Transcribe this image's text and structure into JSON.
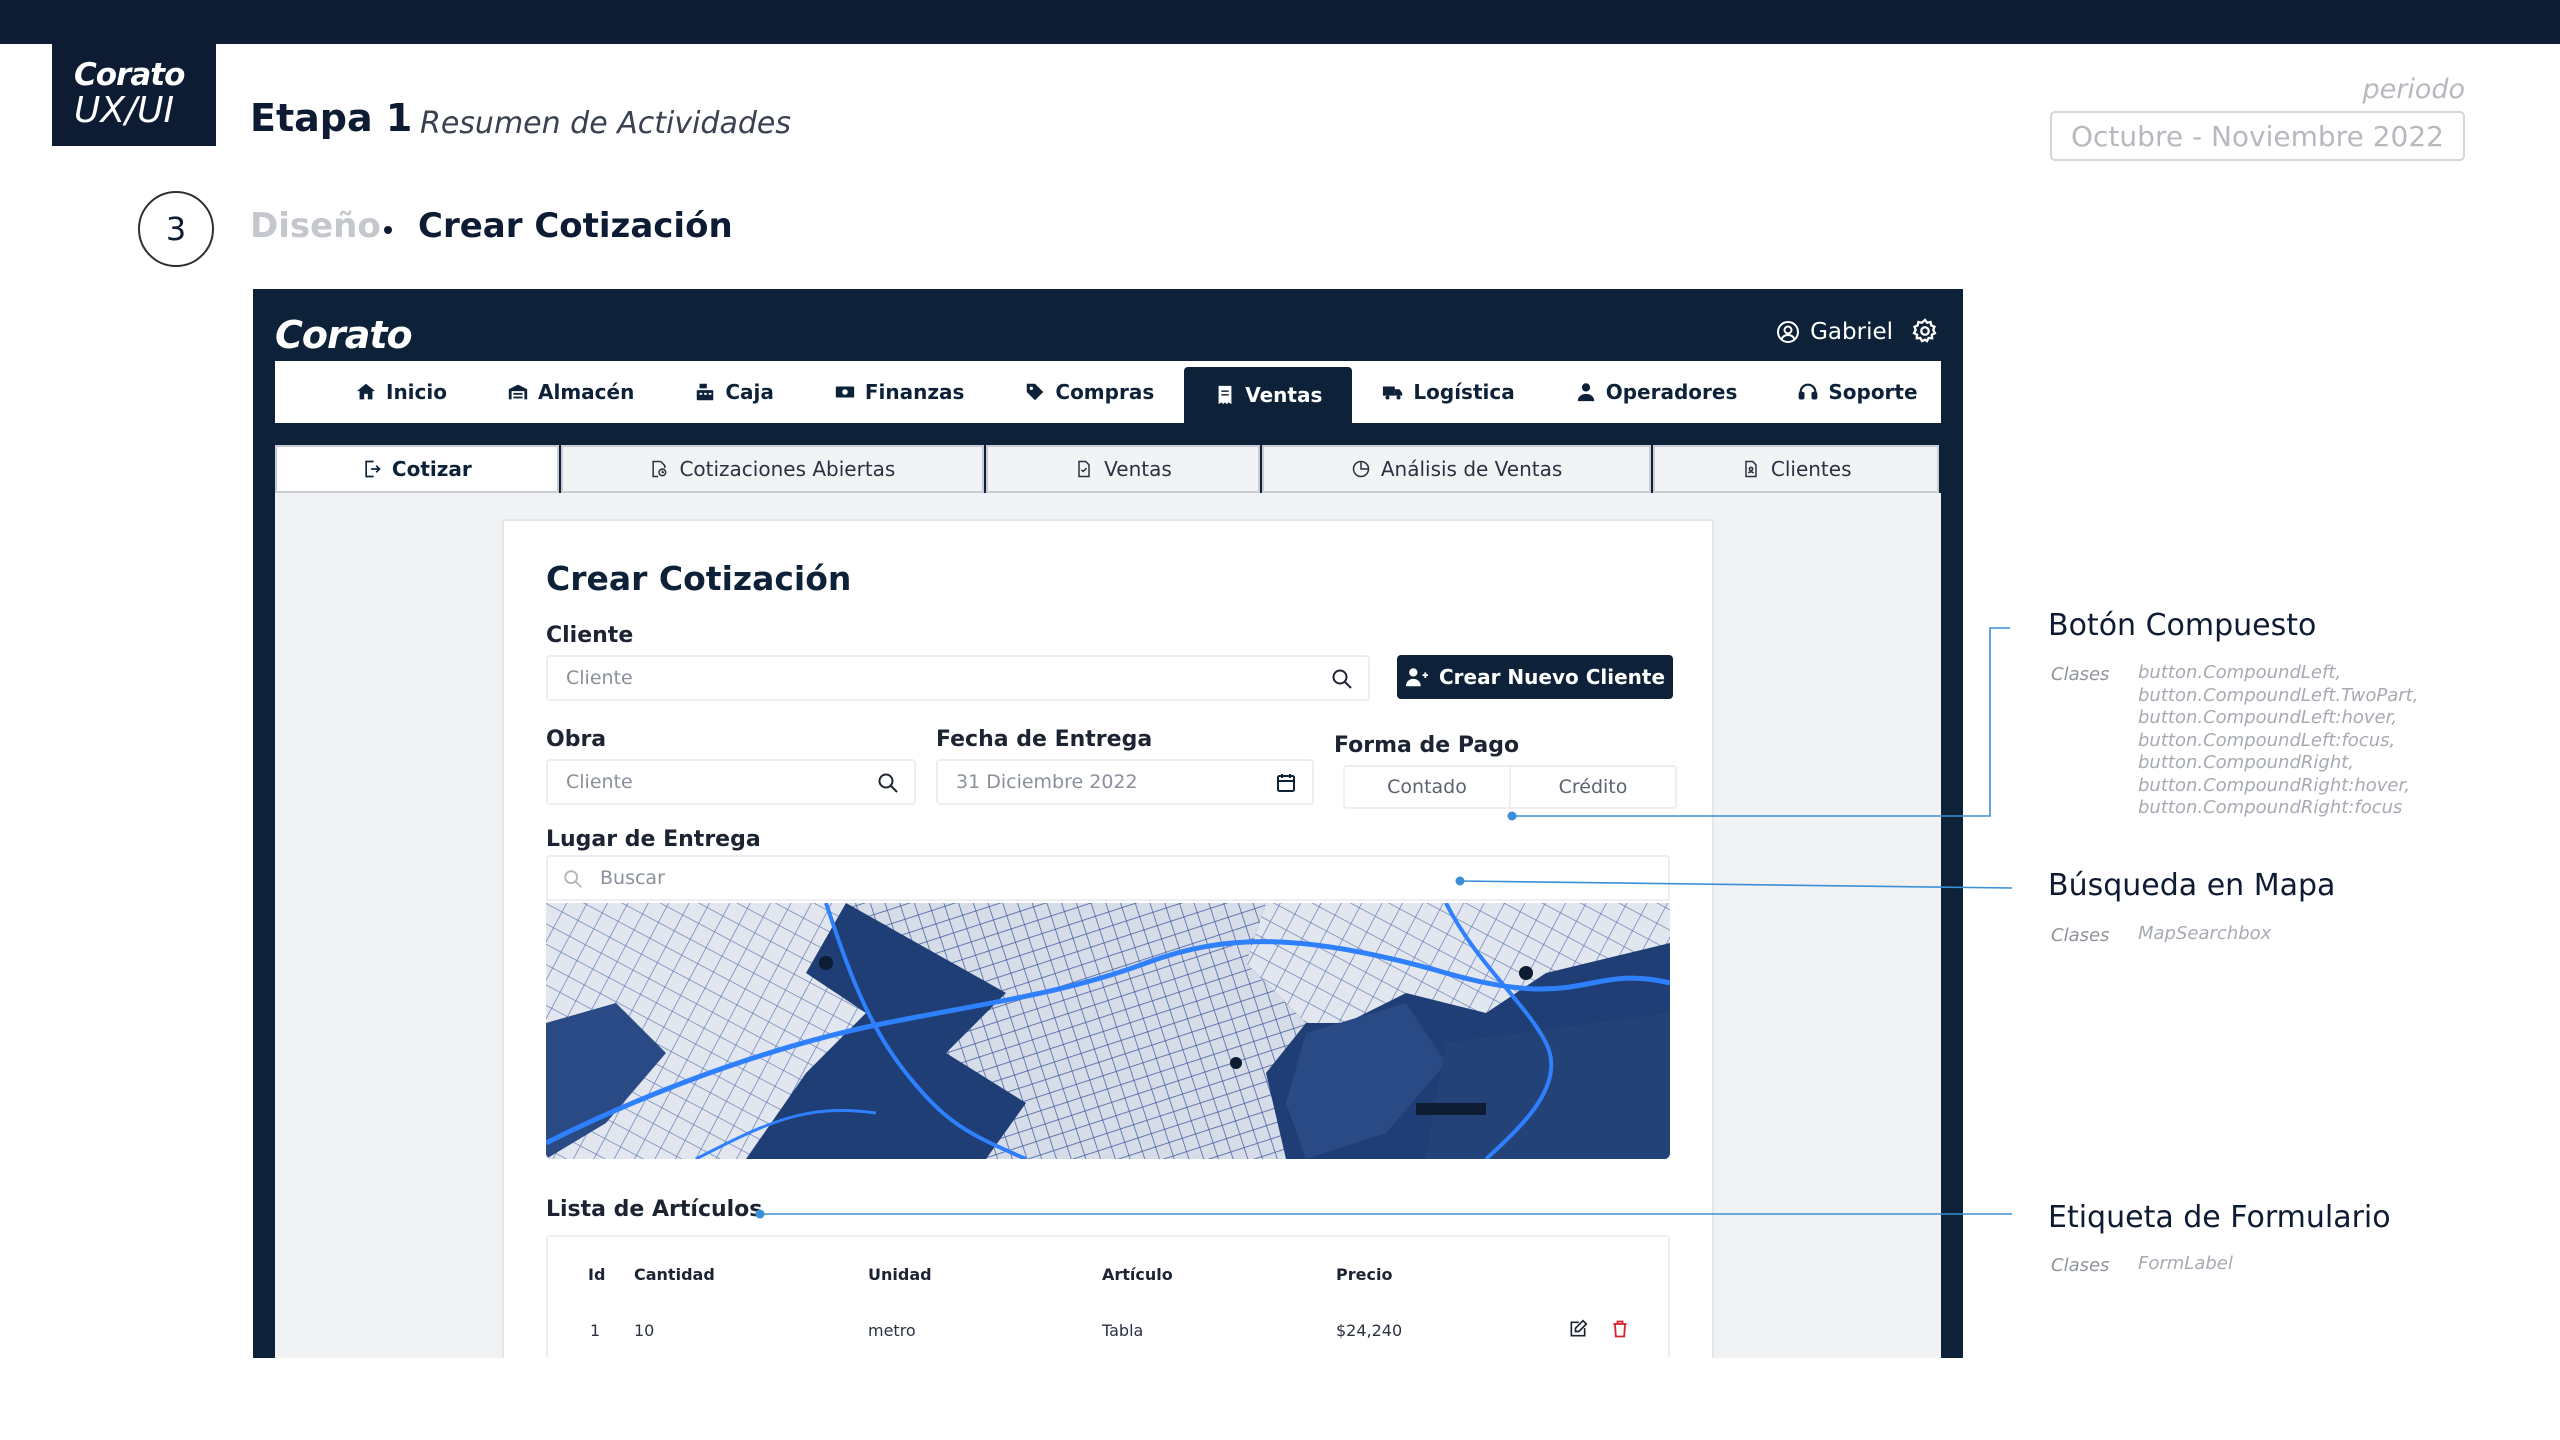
{
  "brand": {
    "line1": "Corato",
    "line2": "UX/UI"
  },
  "header": {
    "stage": "Etapa 1",
    "subtitle": "Resumen de Actividades"
  },
  "period": {
    "label": "periodo",
    "value": "Octubre - Noviembre 2022"
  },
  "step": {
    "number": "3",
    "section": "Diseño",
    "page": "Crear Cotización"
  },
  "app": {
    "logo": "Corato",
    "user": "Gabriel",
    "nav": [
      {
        "label": "Inicio",
        "icon": "home-icon"
      },
      {
        "label": "Almacén",
        "icon": "warehouse-icon"
      },
      {
        "label": "Caja",
        "icon": "cash-register-icon"
      },
      {
        "label": "Finanzas",
        "icon": "money-icon"
      },
      {
        "label": "Compras",
        "icon": "tag-icon"
      },
      {
        "label": "Ventas",
        "icon": "receipt-icon",
        "active": true
      },
      {
        "label": "Logística",
        "icon": "truck-icon"
      },
      {
        "label": "Operadores",
        "icon": "user-icon"
      },
      {
        "label": "Soporte",
        "icon": "headset-icon"
      }
    ],
    "subtabs": [
      {
        "label": "Cotizar",
        "icon": "quote-icon",
        "active": true
      },
      {
        "label": "Cotizaciones Abiertas",
        "icon": "open-quotes-icon"
      },
      {
        "label": "Ventas",
        "icon": "document-icon"
      },
      {
        "label": "Análisis de Ventas",
        "icon": "chart-pie-icon"
      },
      {
        "label": "Clientes",
        "icon": "client-file-icon"
      }
    ],
    "form": {
      "title": "Crear Cotización",
      "cliente_label": "Cliente",
      "cliente_placeholder": "Cliente",
      "new_client_button": "Crear Nuevo Cliente",
      "obra_label": "Obra",
      "obra_placeholder": "Cliente",
      "fecha_label": "Fecha de Entrega",
      "fecha_value": "31 Diciembre 2022",
      "pago_label": "Forma de Pago",
      "pago_options": [
        "Contado",
        "Crédito"
      ],
      "lugar_label": "Lugar de Entrega",
      "lugar_placeholder": "Buscar",
      "list_label": "Lista de Artículos",
      "table": {
        "headers": [
          "Id",
          "Cantidad",
          "Unidad",
          "Artículo",
          "Precio"
        ],
        "rows": [
          [
            "1",
            "10",
            "metro",
            "Tabla",
            "$24,240"
          ]
        ]
      }
    }
  },
  "annotations": [
    {
      "title": "Botón Compuesto",
      "key": "Clases",
      "classes": [
        "button.CompoundLeft,",
        "button.CompoundLeft.TwoPart,",
        "button.CompoundLeft:hover,",
        "button.CompoundLeft:focus,",
        "button.CompoundRight,",
        "button.CompoundRight:hover,",
        "button.CompoundRight:focus"
      ]
    },
    {
      "title": "Búsqueda en Mapa",
      "key": "Clases",
      "classes": [
        "MapSearchbox"
      ]
    },
    {
      "title": "Etiqueta de Formulario",
      "key": "Clases",
      "classes": [
        "FormLabel"
      ]
    }
  ],
  "colors": {
    "navy": "#0d2238",
    "accent_line": "#3a8fd6",
    "map_bg": "#1f3e75"
  }
}
